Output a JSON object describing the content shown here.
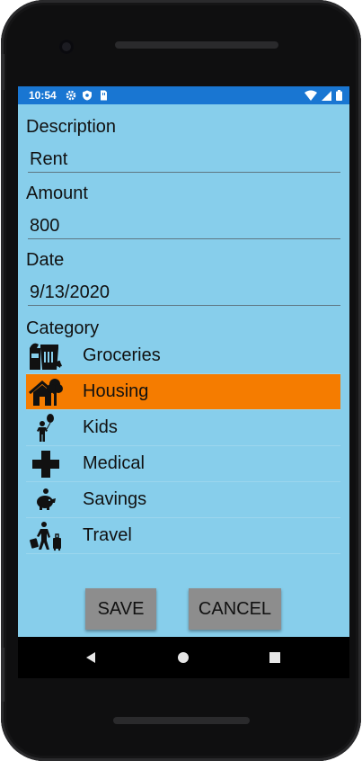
{
  "status_bar": {
    "time": "10:54",
    "icons": [
      "gear-icon",
      "shield-icon",
      "sim-card-icon"
    ],
    "right_icons": [
      "wifi-icon",
      "signal-icon",
      "battery-icon"
    ],
    "color": "#1976d2"
  },
  "form": {
    "description": {
      "label": "Description",
      "value": "Rent"
    },
    "amount": {
      "label": "Amount",
      "value": "800"
    },
    "date": {
      "label": "Date",
      "value": "9/13/2020"
    }
  },
  "category": {
    "label": "Category",
    "selected": "Housing",
    "items": [
      {
        "label": "Groceries",
        "icon": "groceries-icon"
      },
      {
        "label": "Housing",
        "icon": "house-icon"
      },
      {
        "label": "Kids",
        "icon": "kid-balloon-icon"
      },
      {
        "label": "Medical",
        "icon": "medical-cross-icon"
      },
      {
        "label": "Savings",
        "icon": "piggy-bank-icon"
      },
      {
        "label": "Travel",
        "icon": "traveler-luggage-icon"
      }
    ]
  },
  "buttons": {
    "save": "SAVE",
    "cancel": "CANCEL"
  },
  "nav": {
    "back": "back-icon",
    "home": "home-icon",
    "recents": "recents-icon"
  },
  "colors": {
    "background": "#87ceeb",
    "selected": "#f57c00",
    "button": "#8d8d8d"
  }
}
